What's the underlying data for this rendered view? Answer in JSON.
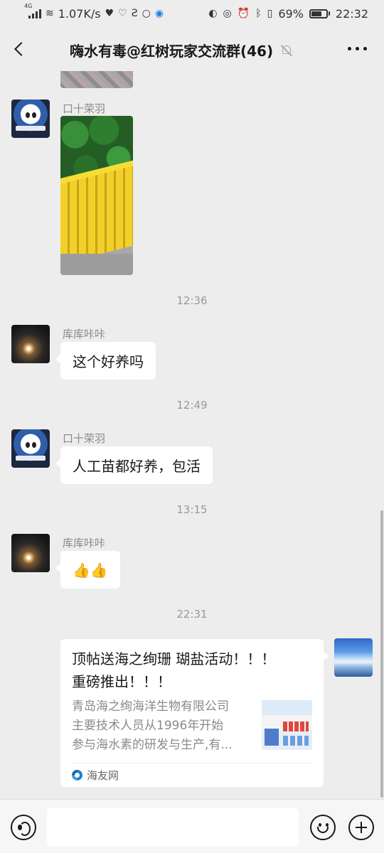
{
  "status_bar": {
    "network": "4G",
    "speed": "1.07K/s",
    "battery": "69%",
    "battery_level": 0.69,
    "time": "22:32"
  },
  "header": {
    "title": "嗨水有毒@红树玩家交流群(46)",
    "back_icon": "chevron-left-icon",
    "mute_icon": "bell-off-icon",
    "more_icon": "more-dots-icon"
  },
  "messages": [
    {
      "type": "image",
      "sender": "口十荣羽",
      "description": "plant-photo"
    },
    {
      "type": "time",
      "text": "12:36"
    },
    {
      "type": "text",
      "sender": "库库咔咔",
      "text": "这个好养吗"
    },
    {
      "type": "time",
      "text": "12:49"
    },
    {
      "type": "text",
      "sender": "口十荣羽",
      "text": "人工苗都好养，包活"
    },
    {
      "type": "time",
      "text": "13:15"
    },
    {
      "type": "text",
      "sender": "库库咔咔",
      "text": "👍👍"
    },
    {
      "type": "time",
      "text": "22:31"
    },
    {
      "type": "link",
      "title_lines": [
        "顶帖送海之绚珊 瑚盐活动！！！",
        "重磅推出！！！"
      ],
      "desc_lines": [
        "青岛海之绚海洋生物有限公司",
        "主要技术人员从1996年开始",
        "参与海水素的研发与生产,有..."
      ],
      "source": "海友网"
    }
  ],
  "input_bar": {
    "voice_icon": "voice-icon",
    "emoji_icon": "emoji-icon",
    "plus_icon": "plus-icon",
    "text": ""
  }
}
